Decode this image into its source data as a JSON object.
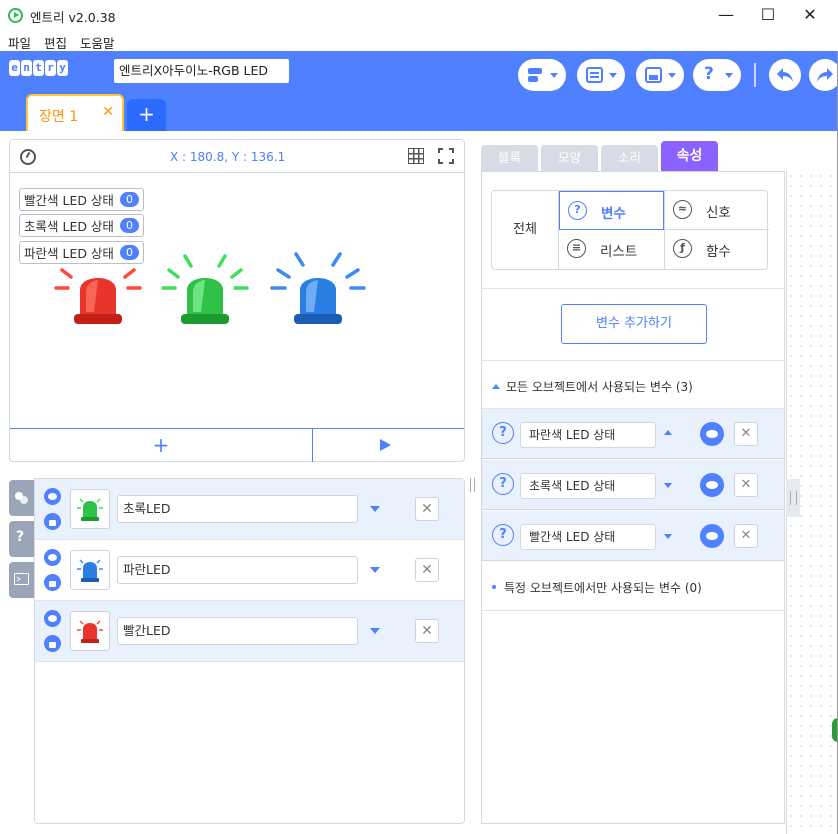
{
  "window": {
    "title": "엔트리 v2.0.38",
    "controls": {
      "minimize": "—",
      "maximize": "☐",
      "close": "✕"
    }
  },
  "menu": {
    "items": [
      "파일",
      "편집",
      "도움말"
    ]
  },
  "toolbar": {
    "logo_letters": [
      "e",
      "n",
      "t",
      "r",
      "y"
    ],
    "project_name": "엔트리X아두이노-RGB LED",
    "buttons": [
      "block-mode-icon",
      "document-icon",
      "save-icon",
      "help-icon"
    ],
    "undo_icon": "undo-icon",
    "redo_icon": "redo-icon"
  },
  "scene": {
    "tab_label": "장면 1",
    "close": "✕",
    "add": "+"
  },
  "stage": {
    "coords": "X : 180.8, Y : 136.1",
    "monitors": [
      {
        "label": "빨간색 LED 상태",
        "value": "0"
      },
      {
        "label": "초록색 LED 상태",
        "value": "0"
      },
      {
        "label": "파란색 LED 상태",
        "value": "0"
      }
    ],
    "sirens": [
      {
        "name": "red-siren",
        "color": "#e8342a"
      },
      {
        "name": "green-siren",
        "color": "#2fc145"
      },
      {
        "name": "blue-siren",
        "color": "#2a7de1"
      }
    ],
    "add_object": "+"
  },
  "side_tabs": [
    "object-tab-icon",
    "help-tab-icon",
    "console-tab-icon"
  ],
  "objects": [
    {
      "name": "초록LED",
      "color": "#2fc145",
      "selected": true
    },
    {
      "name": "파란LED",
      "color": "#2a7de1",
      "selected": false
    },
    {
      "name": "빨간LED",
      "color": "#e8342a",
      "selected": false
    }
  ],
  "tabs": [
    "블록",
    "모양",
    "소리",
    "속성"
  ],
  "active_tab": "속성",
  "properties": {
    "all_label": "전체",
    "categories": [
      {
        "label": "변수",
        "icon": "variable-icon",
        "selected": true
      },
      {
        "label": "신호",
        "icon": "signal-icon",
        "selected": false
      },
      {
        "label": "리스트",
        "icon": "list-icon",
        "selected": false
      },
      {
        "label": "함수",
        "icon": "function-icon",
        "selected": false
      }
    ],
    "add_variable": "변수 추가하기",
    "global_section": "모든 오브젝트에서 사용되는 변수 (3)",
    "variables": [
      "파란색 LED 상태",
      "초록색 LED 상태",
      "빨간색 LED 상태"
    ],
    "local_section": "특정 오브젝트에서만 사용되는 변수 (0)"
  },
  "colors": {
    "primary": "#4f80ff",
    "accent_purple": "#8b62ff",
    "scene_orange": "#ff9600"
  }
}
